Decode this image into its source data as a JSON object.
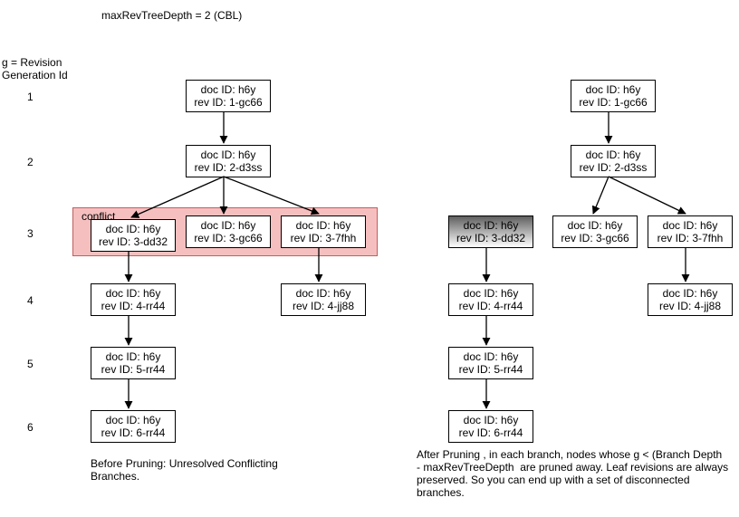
{
  "title": "maxRevTreeDepth = 2 (CBL)",
  "axis_label": "g = Revision\nGeneration Id",
  "generations": [
    "1",
    "2",
    "3",
    "4",
    "5",
    "6"
  ],
  "conflict_label": "conflict",
  "caption_before": "Before Pruning: Unresolved Conflicting\nBranches.",
  "caption_after": "After Pruning , in each branch, nodes whose g < (Branch Depth\n- maxRevTreeDepth  are pruned away. Leaf revisions are always\npreserved. So you can end up with a set of disconnected\nbranches.",
  "doc_prefix": "doc ID: ",
  "rev_prefix": "rev ID: ",
  "nodes": {
    "b1": {
      "doc": "h6y",
      "rev": "1-gc66"
    },
    "b2": {
      "doc": "h6y",
      "rev": "2-d3ss"
    },
    "b3a": {
      "doc": "h6y",
      "rev": "3-dd32"
    },
    "b3b": {
      "doc": "h6y",
      "rev": "3-gc66"
    },
    "b3c": {
      "doc": "h6y",
      "rev": "3-7fhh"
    },
    "b4a": {
      "doc": "h6y",
      "rev": "4-rr44"
    },
    "b4c": {
      "doc": "h6y",
      "rev": "4-jj88"
    },
    "b5": {
      "doc": "h6y",
      "rev": "5-rr44"
    },
    "b6": {
      "doc": "h6y",
      "rev": "6-rr44"
    },
    "a1": {
      "doc": "h6y",
      "rev": "1-gc66"
    },
    "a2": {
      "doc": "h6y",
      "rev": "2-d3ss"
    },
    "a3a": {
      "doc": "h6y",
      "rev": "3-dd32"
    },
    "a3b": {
      "doc": "h6y",
      "rev": "3-gc66"
    },
    "a3c": {
      "doc": "h6y",
      "rev": "3-7fhh"
    },
    "a4a": {
      "doc": "h6y",
      "rev": "4-rr44"
    },
    "a4c": {
      "doc": "h6y",
      "rev": "4-jj88"
    },
    "a5": {
      "doc": "h6y",
      "rev": "5-rr44"
    },
    "a6": {
      "doc": "h6y",
      "rev": "6-rr44"
    }
  },
  "chart_data": {
    "type": "diagram",
    "title": "Revision tree pruning with maxRevTreeDepth = 2 (CBL)",
    "before": {
      "nodes": [
        {
          "id": "b1",
          "g": 1,
          "doc": "h6y",
          "rev": "1-gc66"
        },
        {
          "id": "b2",
          "g": 2,
          "doc": "h6y",
          "rev": "2-d3ss"
        },
        {
          "id": "b3a",
          "g": 3,
          "doc": "h6y",
          "rev": "3-dd32",
          "conflict": true
        },
        {
          "id": "b3b",
          "g": 3,
          "doc": "h6y",
          "rev": "3-gc66",
          "conflict": true
        },
        {
          "id": "b3c",
          "g": 3,
          "doc": "h6y",
          "rev": "3-7fhh",
          "conflict": true
        },
        {
          "id": "b4a",
          "g": 4,
          "doc": "h6y",
          "rev": "4-rr44"
        },
        {
          "id": "b4c",
          "g": 4,
          "doc": "h6y",
          "rev": "4-jj88"
        },
        {
          "id": "b5",
          "g": 5,
          "doc": "h6y",
          "rev": "5-rr44"
        },
        {
          "id": "b6",
          "g": 6,
          "doc": "h6y",
          "rev": "6-rr44"
        }
      ],
      "edges": [
        [
          "b1",
          "b2"
        ],
        [
          "b2",
          "b3a"
        ],
        [
          "b2",
          "b3b"
        ],
        [
          "b2",
          "b3c"
        ],
        [
          "b3a",
          "b4a"
        ],
        [
          "b3c",
          "b4c"
        ],
        [
          "b4a",
          "b5"
        ],
        [
          "b5",
          "b6"
        ]
      ]
    },
    "after": {
      "nodes": [
        {
          "id": "a1",
          "g": 1,
          "doc": "h6y",
          "rev": "1-gc66"
        },
        {
          "id": "a2",
          "g": 2,
          "doc": "h6y",
          "rev": "2-d3ss"
        },
        {
          "id": "a3a",
          "g": 3,
          "doc": "h6y",
          "rev": "3-dd32",
          "tombstone": true
        },
        {
          "id": "a3b",
          "g": 3,
          "doc": "h6y",
          "rev": "3-gc66"
        },
        {
          "id": "a3c",
          "g": 3,
          "doc": "h6y",
          "rev": "3-7fhh"
        },
        {
          "id": "a4a",
          "g": 4,
          "doc": "h6y",
          "rev": "4-rr44"
        },
        {
          "id": "a4c",
          "g": 4,
          "doc": "h6y",
          "rev": "4-jj88"
        },
        {
          "id": "a5",
          "g": 5,
          "doc": "h6y",
          "rev": "5-rr44"
        },
        {
          "id": "a6",
          "g": 6,
          "doc": "h6y",
          "rev": "6-rr44"
        }
      ],
      "edges": [
        [
          "a1",
          "a2"
        ],
        [
          "a2",
          "a3b"
        ],
        [
          "a2",
          "a3c"
        ],
        [
          "a3a",
          "a4a"
        ],
        [
          "a3c",
          "a4c"
        ],
        [
          "a4a",
          "a5"
        ],
        [
          "a5",
          "a6"
        ]
      ]
    }
  }
}
